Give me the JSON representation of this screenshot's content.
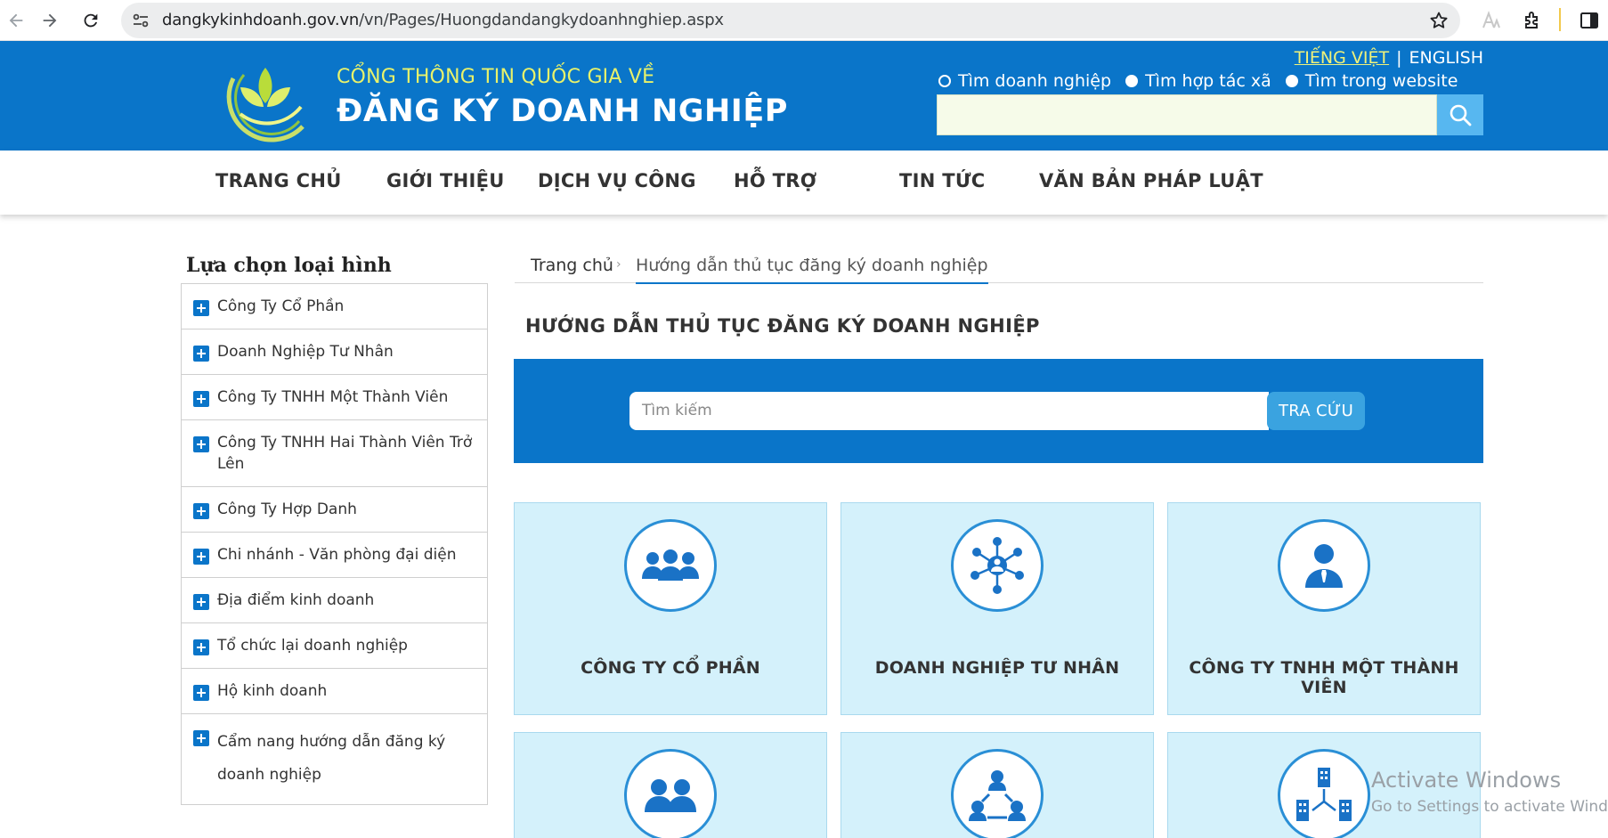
{
  "browser": {
    "url_host": "dangkykinhdoanh.gov.vn",
    "url_path": "/vn/Pages/Huongdandangkydoanhnghiep.aspx"
  },
  "header": {
    "brand_top": "CỔNG THÔNG TIN QUỐC GIA VỀ",
    "brand_main": "ĐĂNG KÝ DOANH NGHIỆP",
    "lang_vi": "TIẾNG VIỆT",
    "lang_sep": "|",
    "lang_en": "ENGLISH",
    "radio_options": [
      "Tìm doanh nghiệp",
      "Tìm hợp tác xã",
      "Tìm trong website"
    ],
    "selected_radio": "Tìm doanh nghiệp",
    "colors": {
      "header_bg": "#0a75c9",
      "brand_accent": "#e9f26a"
    }
  },
  "nav": {
    "items": [
      "TRANG CHỦ",
      "GIỚI THIỆU",
      "DỊCH VỤ CÔNG",
      "HỖ TRỢ",
      "TIN TỨC",
      "VĂN BẢN PHÁP LUẬT"
    ]
  },
  "sidebar": {
    "title": "Lựa chọn loại hình",
    "items": [
      "Công Ty Cổ Phần",
      "Doanh Nghiệp Tư Nhân",
      "Công Ty TNHH Một Thành Viên",
      "Công Ty TNHH Hai Thành Viên Trở Lên",
      "Công Ty Hợp Danh",
      "Chi nhánh - Văn phòng đại diện",
      "Địa điểm kinh doanh",
      "Tổ chức lại doanh nghiệp",
      "Hộ kinh doanh",
      "Cẩm nang hướng dẫn đăng ký doanh nghiệp"
    ]
  },
  "breadcrumb": {
    "home": "Trang chủ",
    "separator": "›",
    "current": "Hướng dẫn thủ tục đăng ký doanh nghiệp"
  },
  "main": {
    "title": "HƯỚNG DẪN THỦ TỤC ĐĂNG KÝ DOANH NGHIỆP",
    "search_placeholder": "Tìm kiếm",
    "search_button": "TRA CỨU",
    "cards": [
      {
        "label": "CÔNG TY CỔ PHẦN",
        "icon": "group-people-icon"
      },
      {
        "label": "DOANH NGHIỆP TƯ NHÂN",
        "icon": "network-person-icon"
      },
      {
        "label": "CÔNG TY TNHH MỘT THÀNH VIÊN",
        "icon": "single-person-icon"
      },
      {
        "label": "",
        "icon": "two-people-icon"
      },
      {
        "label": "",
        "icon": "connected-people-icon"
      },
      {
        "label": "",
        "icon": "buildings-icon"
      }
    ]
  },
  "watermark": {
    "line1": "Activate Windows",
    "line2": "Go to Settings to activate Windows."
  }
}
